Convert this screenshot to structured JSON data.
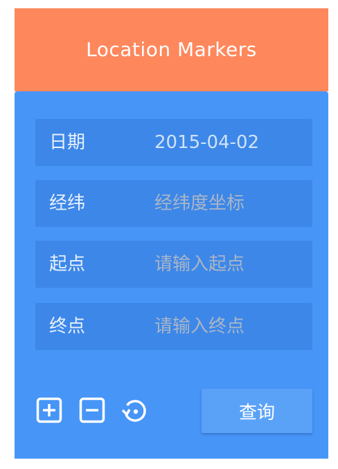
{
  "header": {
    "title": "Location Markers"
  },
  "form": {
    "date": {
      "label": "日期",
      "value": "2015-04-02",
      "placeholder": ""
    },
    "coords": {
      "label": "经纬",
      "value": "",
      "placeholder": "经纬度坐标"
    },
    "start": {
      "label": "起点",
      "value": "",
      "placeholder": "请输入起点"
    },
    "end": {
      "label": "终点",
      "value": "",
      "placeholder": "请输入终点"
    }
  },
  "toolbar": {
    "icons": [
      "plus-square-icon",
      "minus-square-icon",
      "reset-icon"
    ],
    "query_label": "查询"
  },
  "colors": {
    "header_bg": "#ff875c",
    "panel_bg": "#4795f7",
    "field_bg": "#3d87e8",
    "button_bg": "#5aa2f8"
  }
}
